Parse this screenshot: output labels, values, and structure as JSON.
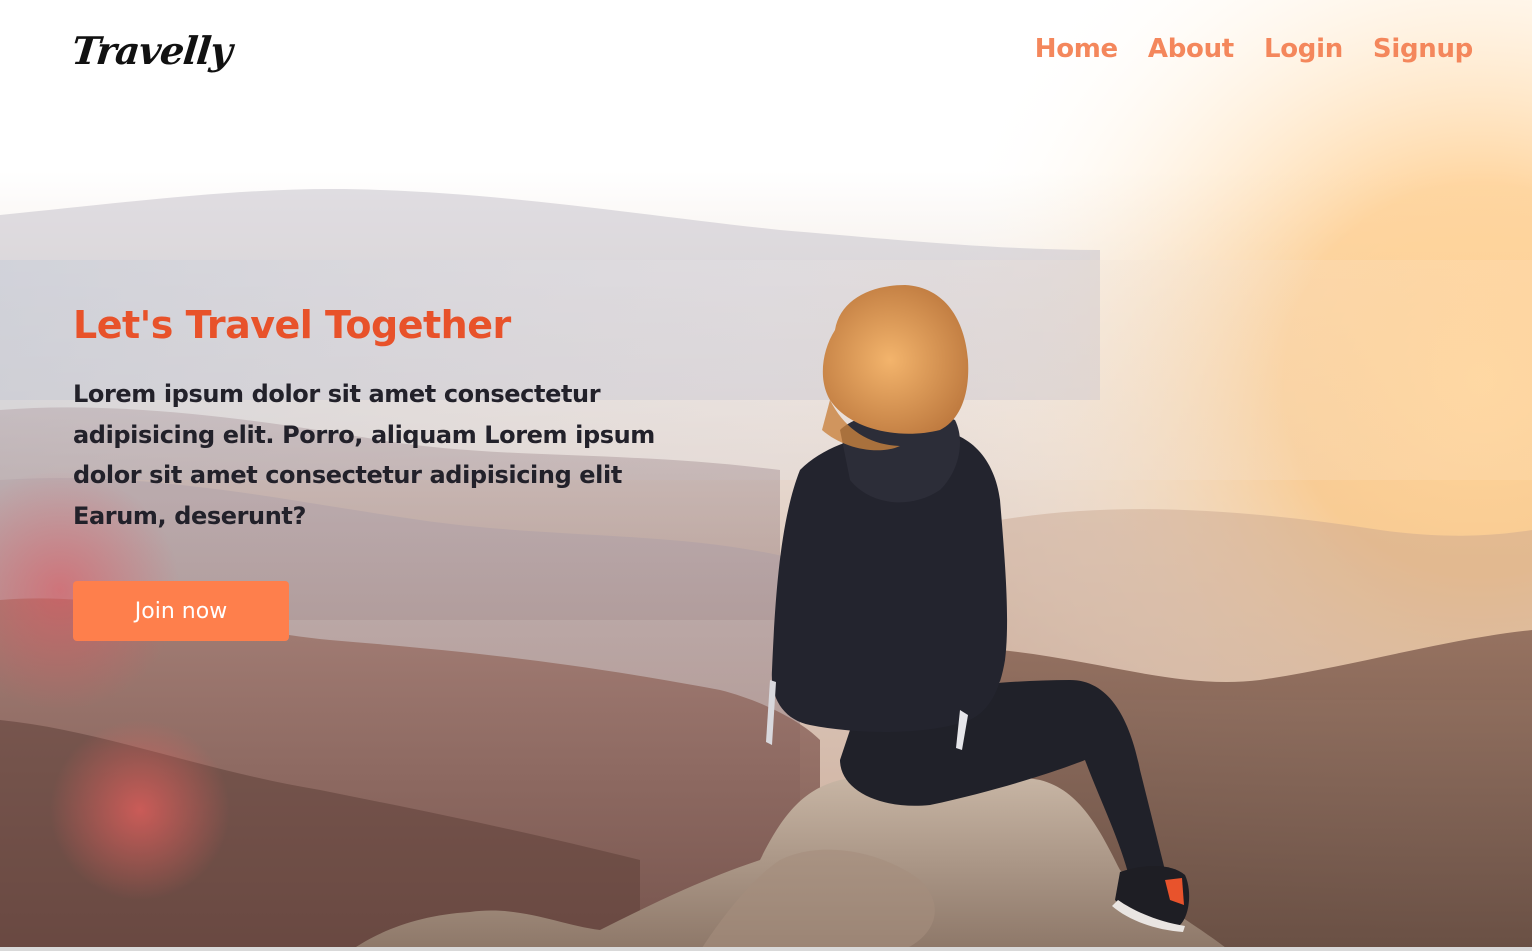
{
  "brand": {
    "logo_text": "Travelly"
  },
  "nav": {
    "items": [
      {
        "label": "Home"
      },
      {
        "label": "About"
      },
      {
        "label": "Login"
      },
      {
        "label": "Signup"
      }
    ]
  },
  "hero": {
    "title": "Let's Travel Together",
    "text": "Lorem ipsum dolor sit amet consectetur adipisicing elit. Porro, aliquam Lorem ipsum dolor sit amet consectetur adipisicing elit Earum, deserunt?",
    "button_label": "Join now",
    "background_image": "photo-woman-sitting-on-rock-overlooking-mountains-at-sunset"
  },
  "colors": {
    "nav_link": "#f4875c",
    "title": "#e8522a",
    "button": "#fe7f4c",
    "body_text": "#22212a"
  }
}
